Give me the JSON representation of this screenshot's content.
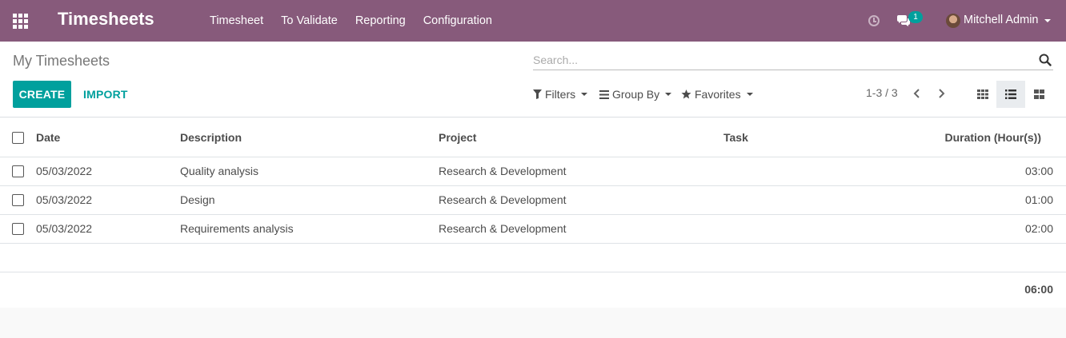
{
  "app": {
    "title": "Timesheets",
    "menu": [
      "Timesheet",
      "To Validate",
      "Reporting",
      "Configuration"
    ],
    "chat_badge": "1",
    "user_name": "Mitchell Admin"
  },
  "control": {
    "breadcrumb": "My Timesheets",
    "search_placeholder": "Search...",
    "create_label": "CREATE",
    "import_label": "IMPORT",
    "filters_label": "Filters",
    "groupby_label": "Group By",
    "favorites_label": "Favorites",
    "pager": "1-3 / 3"
  },
  "table": {
    "headers": {
      "date": "Date",
      "description": "Description",
      "project": "Project",
      "task": "Task",
      "duration": "Duration (Hour(s))"
    },
    "rows": [
      {
        "date": "05/03/2022",
        "description": "Quality analysis",
        "project": "Research & Development",
        "task": "",
        "duration": "03:00"
      },
      {
        "date": "05/03/2022",
        "description": "Design",
        "project": "Research & Development",
        "task": "",
        "duration": "01:00"
      },
      {
        "date": "05/03/2022",
        "description": "Requirements analysis",
        "project": "Research & Development",
        "task": "",
        "duration": "02:00"
      }
    ],
    "total": "06:00"
  },
  "colors": {
    "brand": "#875a7b",
    "accent": "#00a09d"
  }
}
